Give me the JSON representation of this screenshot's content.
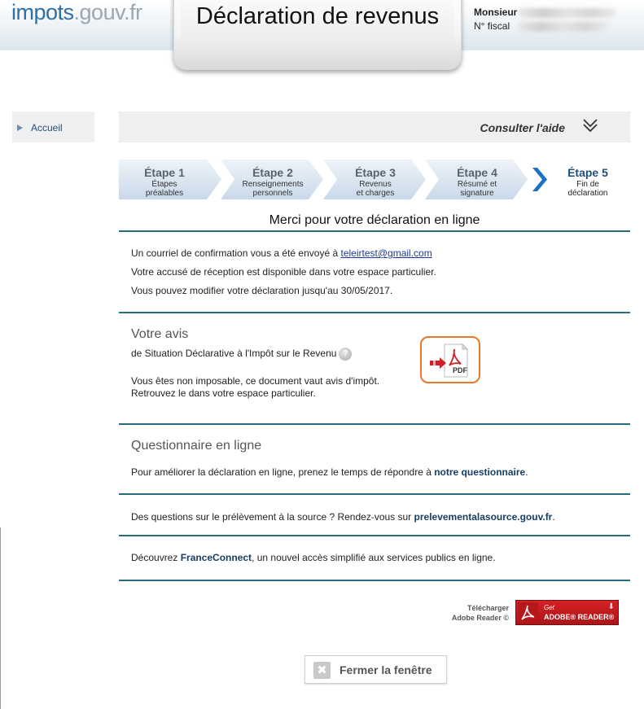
{
  "header": {
    "logo_part1": "impots",
    "logo_part2": ".gouv.fr",
    "title": "Déclaration de revenus",
    "user_label": "Monsieur",
    "fiscal_label": "N° fiscal"
  },
  "sidebar": {
    "items": [
      {
        "label": "Accueil"
      }
    ]
  },
  "help": {
    "label": "Consulter l'aide"
  },
  "steps": [
    {
      "num": "Étape 1",
      "label1": "Étapes",
      "label2": "préalables"
    },
    {
      "num": "Étape 2",
      "label1": "Renseignements",
      "label2": "personnels"
    },
    {
      "num": "Étape 3",
      "label1": "Revenus",
      "label2": "et charges"
    },
    {
      "num": "Étape 4",
      "label1": "Résumé et",
      "label2": "signature"
    },
    {
      "num": "Étape 5",
      "label1": "Fin de",
      "label2": "déclaration"
    }
  ],
  "confirmation": {
    "title": "Merci pour votre déclaration en ligne",
    "email_prefix": "Un courriel de confirmation vous a été envoyé à ",
    "email": "teleirtest@gmail.com",
    "receipt": "Votre accusé de réception est disponible dans votre espace particulier.",
    "modify": "Vous pouvez modifier votre déclaration jusqu'au 30/05/2017."
  },
  "avis": {
    "title": "Votre avis",
    "subtitle": "de Situation Déclarative à l'Impôt sur le Revenu",
    "help_glyph": "?",
    "line1": "Vous êtes non imposable, ce document vaut avis d'impôt.",
    "line2": "Retrouvez le dans votre espace particulier.",
    "pdf_label": "PDF"
  },
  "questionnaire": {
    "title": "Questionnaire en ligne",
    "text_prefix": "Pour améliorer la déclaration en ligne, prenez le temps de répondre à ",
    "link": "notre questionnaire",
    "text_suffix": "."
  },
  "prelevement": {
    "text_prefix": "Des questions sur le prélèvement à la source ? Rendez-vous sur ",
    "link": "prelevementalasource.gouv.fr",
    "text_suffix": "."
  },
  "franceconnect": {
    "text_prefix": "Découvrez ",
    "link": "FranceConnect",
    "text_suffix": ", un nouvel accès simplifié aux services publics en ligne."
  },
  "adobe": {
    "line1": "Télécharger",
    "line2": "Adobe Reader ©",
    "badge_get": "Get",
    "badge_name": "ADOBE® READER®"
  },
  "close": {
    "label": "Fermer la fenêtre",
    "icon_glyph": "✖"
  },
  "colors": {
    "brand_blue": "#1f4e79",
    "rule": "#2a6a7e",
    "pdf_border": "#e8782a",
    "adobe_red": "#d62024"
  }
}
